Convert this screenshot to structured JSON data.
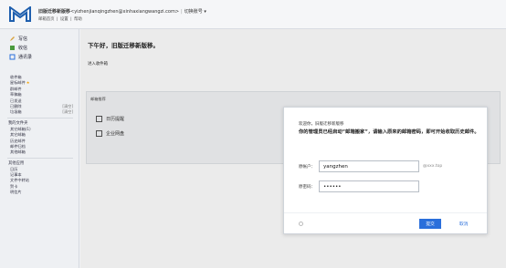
{
  "header": {
    "account_name": "旧版迁移新版移",
    "account_email": "<yizhenjianqingzhen@xinhaxiangwangzi.com>",
    "separator": "|",
    "switch_label": "切换账号",
    "links": [
      "邮箱首页",
      "|",
      "设置",
      "|",
      "帮助"
    ]
  },
  "sidebar": {
    "compose": "写信",
    "receive": "收信",
    "contacts": "通讯录",
    "folders": [
      {
        "label": "收件箱",
        "count": ""
      },
      {
        "label": "星标邮件",
        "count": "",
        "star": true
      },
      {
        "label": "群邮件",
        "count": ""
      },
      {
        "label": "草稿箱",
        "count": ""
      },
      {
        "label": "已发送",
        "count": ""
      },
      {
        "label": "已删除",
        "count": "[清空]"
      },
      {
        "label": "垃圾箱",
        "count": "[清空]"
      }
    ],
    "my_folders_title": "我的文件夹",
    "my_folders": [
      {
        "label": "其它邮箱(1)",
        "count": ""
      },
      {
        "label": "其它邮箱",
        "count": ""
      },
      {
        "label": "历史邮件",
        "count": ""
      },
      {
        "label": "邮件归档",
        "count": ""
      },
      {
        "label": "其他邮箱",
        "count": ""
      }
    ],
    "apps_title": "其他应用",
    "apps": [
      {
        "label": "日历",
        "count": ""
      },
      {
        "label": "记事本",
        "count": ""
      },
      {
        "label": "文件中转站",
        "count": ""
      },
      {
        "label": "贺卡",
        "count": ""
      },
      {
        "label": "明信片",
        "count": ""
      }
    ]
  },
  "main": {
    "greeting": "下午好，旧版迁移新版移。",
    "sub1": "",
    "sub2": "进入收件箱",
    "panel_title": "邮箱推荐",
    "rows": [
      "日历提醒",
      "企业网盘"
    ],
    "footer1": "",
    "footer2": ""
  },
  "modal": {
    "hello": "欢迎你，旧版迁移新版移",
    "message": "你的管理员已经启动“邮箱搬家”，请输入原来的邮箱密码，即可开始收取历史邮件。",
    "account_label": "原帐户：",
    "account_value": "yangzhen",
    "account_suffix": "@xxx.top",
    "password_label": "原密码：",
    "password_value": "••••••",
    "hint": "",
    "foot_note": "",
    "submit": "提交",
    "cancel": "取消"
  }
}
